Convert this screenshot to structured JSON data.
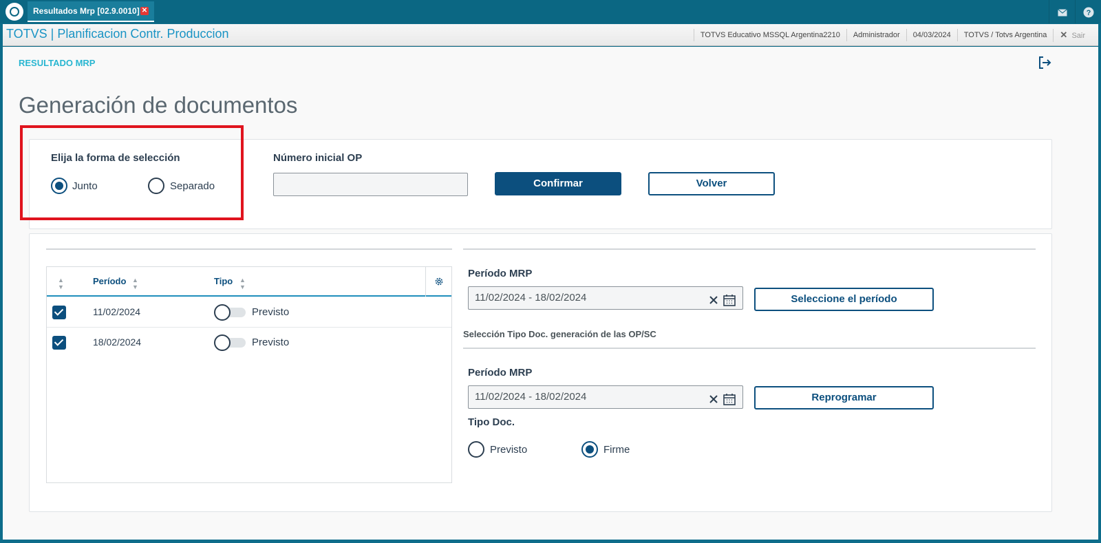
{
  "topbar": {
    "tab_label": "Resultados Mrp [02.9.0010]",
    "icons": [
      "mail-icon",
      "help-icon"
    ]
  },
  "header": {
    "title": "TOTVS | Planificacion Contr. Produccion",
    "environment": "TOTVS Educativo MSSQL Argentina2210",
    "user": "Administrador",
    "date": "04/03/2024",
    "company": "TOTVS / Totvs Argentina",
    "logout": "Sair"
  },
  "page": {
    "breadcrumb": "RESULTADO MRP",
    "title": "Generación de documentos"
  },
  "selection": {
    "label": "Elija la forma de selección",
    "options": [
      {
        "label": "Junto",
        "selected": true
      },
      {
        "label": "Separado",
        "selected": false
      }
    ]
  },
  "op": {
    "label": "Número inicial OP",
    "value": ""
  },
  "buttons": {
    "confirm": "Confirmar",
    "back": "Volver",
    "select_period": "Seleccione el período",
    "reprogram": "Reprogramar"
  },
  "table": {
    "columns": [
      "Período",
      "Tipo"
    ],
    "rows": [
      {
        "checked": true,
        "period": "11/02/2024",
        "tipo": "Previsto",
        "switch_on": false
      },
      {
        "checked": true,
        "period": "18/02/2024",
        "tipo": "Previsto",
        "switch_on": false
      }
    ]
  },
  "mrp1": {
    "label": "Período MRP",
    "value": "11/02/2024 - 18/02/2024"
  },
  "section_label": "Selección Tipo Doc. generación de las OP/SC",
  "mrp2": {
    "label": "Período MRP",
    "value": "11/02/2024 - 18/02/2024"
  },
  "tipo_doc": {
    "label": "Tipo Doc.",
    "options": [
      {
        "label": "Previsto",
        "selected": false
      },
      {
        "label": "Firme",
        "selected": true
      }
    ]
  },
  "colors": {
    "primary": "#0c4f7e",
    "brand": "#0b6783",
    "highlight": "#e0141e"
  }
}
